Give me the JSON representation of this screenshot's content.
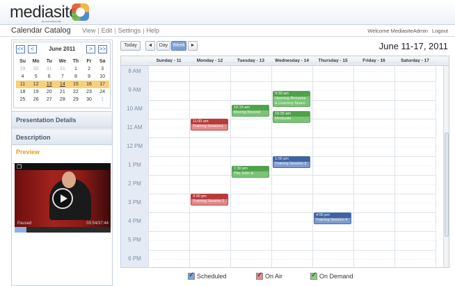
{
  "app": {
    "logo_text": "mediasite",
    "logo_sub": "by sonicfoundry"
  },
  "menubar": {
    "title": "Calendar Catalog",
    "nav": [
      "View",
      "Edit",
      "Settings",
      "Help"
    ],
    "welcome": "Welcome MediasiteAdmin",
    "logout": "Logout"
  },
  "minical": {
    "prev_year": "<<",
    "prev_month": "<",
    "next_month": ">",
    "next_year": ">>",
    "month": "June 2011",
    "days": [
      "Su",
      "Mo",
      "Tu",
      "We",
      "Th",
      "Fr",
      "Sa"
    ],
    "weeks": [
      [
        "29",
        "30",
        "31",
        "31",
        "1",
        "2",
        "3"
      ],
      [
        "4",
        "5",
        "6",
        "7",
        "8",
        "9",
        "10"
      ],
      [
        "11",
        "12",
        "13",
        "14",
        "15",
        "16",
        "17"
      ],
      [
        "18",
        "19",
        "20",
        "21",
        "22",
        "23",
        "24"
      ],
      [
        "25",
        "26",
        "27",
        "28",
        "29",
        "30",
        "1"
      ]
    ]
  },
  "panels": {
    "presentation_details": "Presentation Details",
    "description": "Description",
    "preview": "Preview"
  },
  "video": {
    "status": "Paused",
    "time": "03:54/37:44",
    "progress": 0.12
  },
  "toolbar": {
    "today": "Today",
    "prev": "◄",
    "day": "Day",
    "week": "Week",
    "next": "►",
    "range": "June  11-17, 2011"
  },
  "calendar": {
    "days": [
      "Sunday - 11",
      "Monday - 12",
      "Tuesday - 13",
      "Wednesday - 14",
      "Thursday - 15",
      "Friday - 16",
      "Saturday - 17"
    ],
    "hours": [
      "8 AM",
      "9 AM",
      "10 AM",
      "11 AM",
      "12 PM",
      "1 PM",
      "2 PM",
      "3 PM",
      "4 PM",
      "5 PM",
      "6 PM"
    ],
    "events": [
      {
        "time": "9:30 am",
        "name": "Opening Remarks & Learning Space",
        "kind": "green",
        "day": 3
      },
      {
        "time": "10:15 am",
        "name": "Moving Beyond",
        "kind": "green",
        "day": 2
      },
      {
        "time": "10:35 am",
        "name": "Mediasite",
        "kind": "green",
        "day": 3
      },
      {
        "time": "11:00 am",
        "name": "Training Session1",
        "kind": "red",
        "day": 1
      },
      {
        "time": "1:30 pm",
        "name": "The John &",
        "kind": "green",
        "day": 2
      },
      {
        "time": "1:00 pm",
        "name": "Training Session 3",
        "kind": "blue",
        "day": 3
      },
      {
        "time": "3:00 pm",
        "name": "Training Session 2",
        "kind": "red",
        "day": 1
      },
      {
        "time": "4:00 pm",
        "name": "Training Session 4",
        "kind": "blue",
        "day": 4
      }
    ]
  },
  "legend": {
    "scheduled": "Scheduled",
    "on_air": "On Air",
    "on_demand": "On Demand"
  }
}
